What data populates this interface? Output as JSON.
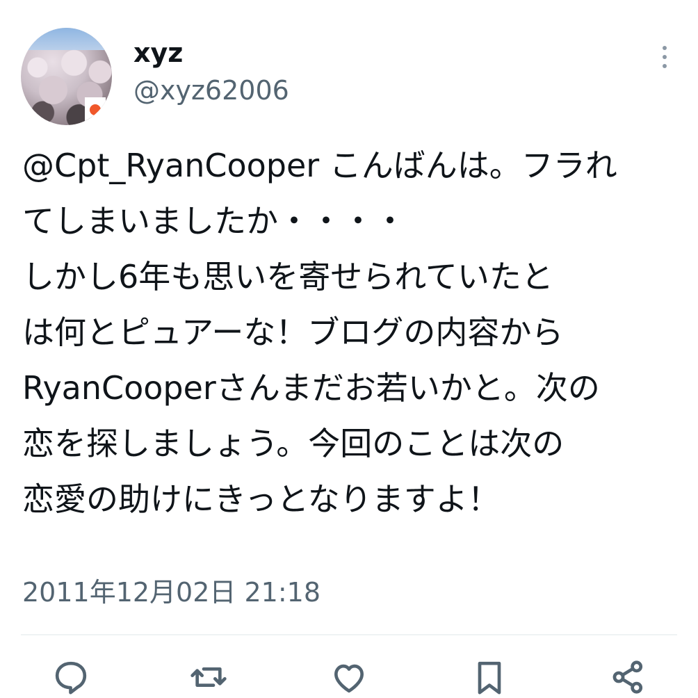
{
  "tweet": {
    "display_name": "xyz",
    "handle": "@xyz62006",
    "lines": [
      "@Cpt_RyanCooper こんばんは。フラれ",
      "てしまいましたか・・・・",
      "しかし6年も思いを寄せられていたと",
      "は何とピュアーな！ブログの内容から",
      "RyanCooperさんまだお若いかと。次の",
      "恋を探しましょう。今回のことは次の",
      "恋愛の助けにきっとなりますよ！"
    ],
    "timestamp": "2011年12月02日 21:18"
  },
  "actions": {
    "icons": [
      "reply-icon",
      "retweet-icon",
      "like-icon",
      "bookmark-icon",
      "share-icon"
    ]
  },
  "colors": {
    "text_primary": "#0f1419",
    "text_secondary": "#536471",
    "divider": "#eff3f4",
    "icon": "#536471"
  }
}
